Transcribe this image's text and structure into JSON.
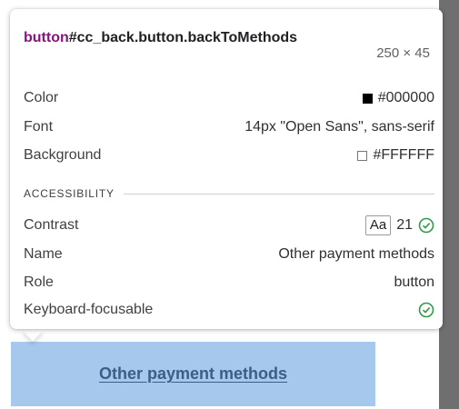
{
  "tooltip": {
    "selector_tag": "button",
    "selector_rest": "#cc_back.button.backToMethods",
    "dimensions": "250 × 45",
    "rows": {
      "color": {
        "label": "Color",
        "value": "#000000"
      },
      "font": {
        "label": "Font",
        "value": "14px \"Open Sans\", sans-serif"
      },
      "background": {
        "label": "Background",
        "value": "#FFFFFF"
      }
    },
    "accessibility": {
      "heading": "ACCESSIBILITY",
      "contrast": {
        "label": "Contrast",
        "badge": "Aa",
        "value": "21"
      },
      "name": {
        "label": "Name",
        "value": "Other payment methods"
      },
      "role": {
        "label": "Role",
        "value": "button"
      },
      "keyboard": {
        "label": "Keyboard-focusable"
      }
    }
  },
  "page": {
    "button_label": "Other payment methods"
  },
  "colors": {
    "check": "#2e9b48",
    "highlight": "#a6c8ec",
    "selector_tag": "#881280"
  }
}
